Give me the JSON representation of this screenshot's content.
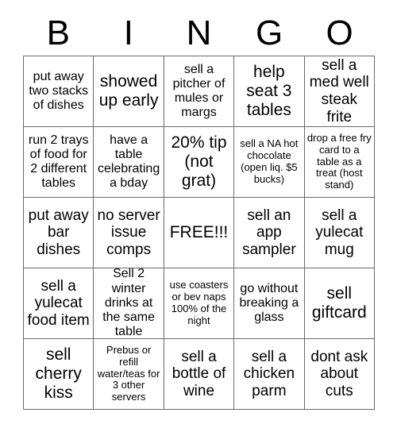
{
  "card": {
    "title_letters": [
      "B",
      "I",
      "N",
      "G",
      "O"
    ],
    "free_space_label": "FREE!!!",
    "rows": [
      [
        {
          "text": "put away two stacks of dishes",
          "size": "md"
        },
        {
          "text": "showed up early",
          "size": "xl"
        },
        {
          "text": "sell a pitcher of mules or margs",
          "size": "md"
        },
        {
          "text": "help seat 3 tables",
          "size": "xl"
        },
        {
          "text": "sell a med well steak frite",
          "size": "lg"
        }
      ],
      [
        {
          "text": "run 2 trays of food for 2 different tables",
          "size": "md"
        },
        {
          "text": "have a table celebrating a bday",
          "size": "md"
        },
        {
          "text": "20% tip (not grat)",
          "size": "xl"
        },
        {
          "text": "sell a NA hot chocolate (open liq. $5 bucks)",
          "size": "sm"
        },
        {
          "text": "drop a free fry card to a table as a treat (host stand)",
          "size": "sm"
        }
      ],
      [
        {
          "text": "put away bar dishes",
          "size": "lg"
        },
        {
          "text": "no server issue comps",
          "size": "lg"
        },
        {
          "text": "FREE!!!",
          "size": "xl"
        },
        {
          "text": "sell an app sampler",
          "size": "lg"
        },
        {
          "text": "sell a yulecat mug",
          "size": "lg"
        }
      ],
      [
        {
          "text": "sell a yulecat food item",
          "size": "lg"
        },
        {
          "text": "Sell 2 winter drinks at the same table",
          "size": "md"
        },
        {
          "text": "use coasters or bev naps 100% of the night",
          "size": "sm"
        },
        {
          "text": "go without breaking a glass",
          "size": "md"
        },
        {
          "text": "sell giftcard",
          "size": "xl"
        }
      ],
      [
        {
          "text": "sell cherry kiss",
          "size": "xl"
        },
        {
          "text": "Prebus or refill water/teas for 3 other servers",
          "size": "sm"
        },
        {
          "text": "sell a bottle of wine",
          "size": "lg"
        },
        {
          "text": "sell a chicken parm",
          "size": "lg"
        },
        {
          "text": "dont ask about cuts",
          "size": "lg"
        }
      ]
    ]
  },
  "colors": {
    "background": "#ffffff",
    "text": "#000000",
    "grid_line": "#6b6b6b"
  }
}
